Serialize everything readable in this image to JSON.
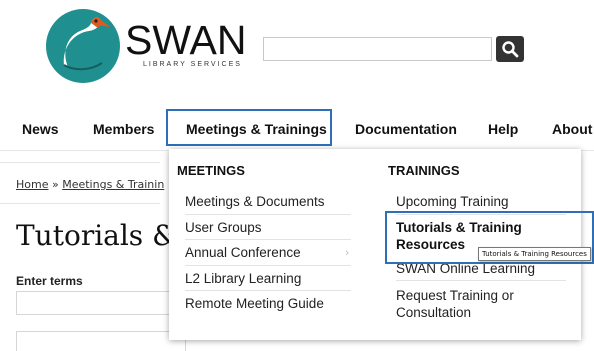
{
  "header": {
    "logo_word": "SWAN",
    "logo_sub": "LIBRARY SERVICES",
    "brand_teal": "#1f8f8f",
    "search": {
      "value": "",
      "icon": "search-icon"
    }
  },
  "nav": {
    "items": [
      "News",
      "Members",
      "Meetings & Trainings",
      "Documentation",
      "Help",
      "About"
    ],
    "active_index": 2,
    "accent": "#2f6fb6"
  },
  "breadcrumb": {
    "home": "Home",
    "sep": "»",
    "meetings": "Meetings & Trainin"
  },
  "page": {
    "title": "Tutorials & T",
    "enter_terms": "Enter terms"
  },
  "dropdown": {
    "meetings": {
      "heading": "MEETINGS",
      "items": [
        "Meetings & Documents",
        "User Groups",
        "Annual Conference",
        "L2 Library Learning",
        "Remote Meeting Guide"
      ],
      "submenu_index": 2
    },
    "trainings": {
      "heading": "TRAININGS",
      "items": [
        "Upcoming Training",
        "Tutorials & Training Resources",
        "SWAN Online Learning",
        "Request Training or Consultation"
      ],
      "hovered_index": 1,
      "hovered_line1": "Tutorials & Training",
      "hovered_line2": "Resources",
      "request_line1": "Request Training or",
      "request_line2": "Consultation"
    }
  },
  "tooltip": "Tutorials & Training Resources"
}
